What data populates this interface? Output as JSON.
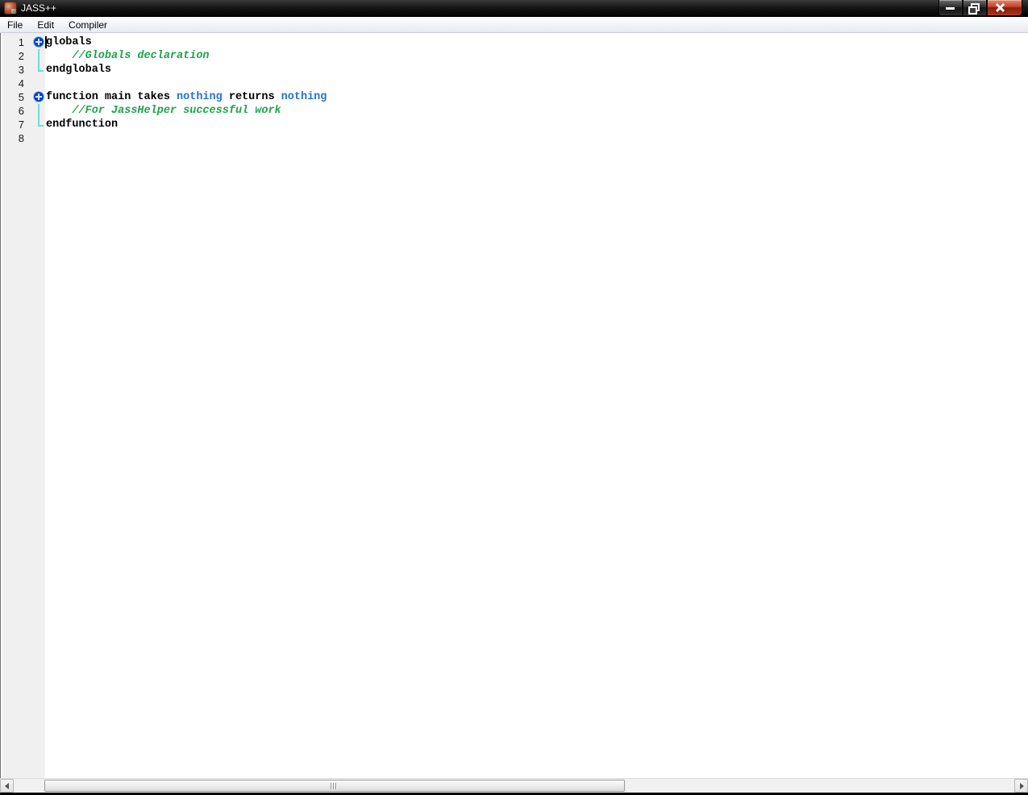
{
  "window": {
    "title": "JASS++",
    "icon": "jass-app-icon"
  },
  "titlebar": {
    "buttons": [
      {
        "name": "minimize",
        "icon": "minimize-icon"
      },
      {
        "name": "restore",
        "icon": "restore-icon"
      },
      {
        "name": "close",
        "icon": "close-icon"
      }
    ]
  },
  "menubar": {
    "items": [
      {
        "label": "File"
      },
      {
        "label": "Edit"
      },
      {
        "label": "Compiler"
      }
    ]
  },
  "editor": {
    "language": "JASS",
    "caret_position": {
      "line": 1,
      "column": 1
    },
    "lines": [
      {
        "num": "1",
        "fold": "expand",
        "tokens": [
          {
            "text": "globals",
            "style": "keyword"
          }
        ]
      },
      {
        "num": "2",
        "fold": "line",
        "tokens": [
          {
            "text": "    //Globals declaration",
            "style": "comment"
          }
        ]
      },
      {
        "num": "3",
        "fold": "elbow",
        "tokens": [
          {
            "text": "endglobals",
            "style": "keyword"
          }
        ]
      },
      {
        "num": "4",
        "fold": "none",
        "tokens": []
      },
      {
        "num": "5",
        "fold": "expand",
        "tokens": [
          {
            "text": "function main takes ",
            "style": "keyword"
          },
          {
            "text": "nothing",
            "style": "type"
          },
          {
            "text": " returns ",
            "style": "keyword"
          },
          {
            "text": "nothing",
            "style": "type"
          }
        ]
      },
      {
        "num": "6",
        "fold": "line",
        "tokens": [
          {
            "text": "    //For JassHelper successful work",
            "style": "comment"
          }
        ]
      },
      {
        "num": "7",
        "fold": "elbow",
        "tokens": [
          {
            "text": "endfunction",
            "style": "keyword"
          }
        ]
      },
      {
        "num": "8",
        "fold": "none",
        "tokens": []
      }
    ],
    "colors": {
      "keyword": "#000000",
      "type": "#2472c8",
      "comment": "#1fa24d",
      "fold_line": "#6fdce0",
      "fold_marker": "#1c35d4",
      "gutter_bg": "#f0f0f0"
    }
  },
  "scrollbar": {
    "orientation": "horizontal",
    "left_arrow_icon": "scroll-left-arrow-icon",
    "right_arrow_icon": "scroll-right-arrow-icon",
    "thumb_grip_icon": "thumb-grip-icon"
  }
}
